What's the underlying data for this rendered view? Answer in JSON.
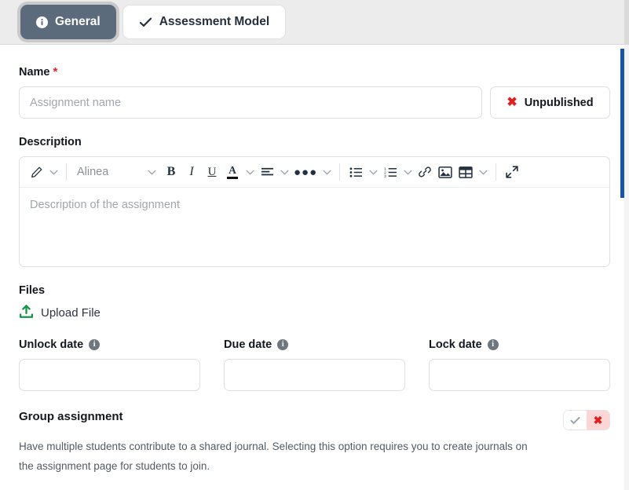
{
  "tabs": [
    {
      "label": "General",
      "icon": "info-circle-icon",
      "active": true
    },
    {
      "label": "Assessment Model",
      "icon": "check-icon",
      "active": false
    }
  ],
  "name_section": {
    "label": "Name",
    "required_marker": "*",
    "placeholder": "Assignment name",
    "value": "",
    "publish_button": {
      "label": "Unpublished",
      "icon": "x-icon",
      "icon_color": "#e02020"
    }
  },
  "description_section": {
    "label": "Description",
    "placeholder": "Description of the assignment",
    "value": "",
    "toolbar": {
      "style_picker_icon": "pencil-icon",
      "font_name": "Alinea",
      "bold_label": "B",
      "italic_label": "I",
      "underline_label": "U",
      "text_color_label": "A",
      "text_color_swatch": "#111111",
      "align_icon": "align-left-icon",
      "more_icon": "ellipsis-icon",
      "bullet_list_icon": "bullet-list-icon",
      "numbered_list_icon": "numbered-list-icon",
      "link_icon": "link-icon",
      "image_icon": "image-icon",
      "table_icon": "table-icon",
      "fullscreen_icon": "fullscreen-icon"
    }
  },
  "files_section": {
    "label": "Files",
    "upload_label": "Upload File",
    "upload_icon": "upload-icon",
    "upload_icon_color": "#159445"
  },
  "dates": [
    {
      "label": "Unlock date",
      "info_icon": "info-icon",
      "value": "",
      "name": "unlock-date"
    },
    {
      "label": "Due date",
      "info_icon": "info-icon",
      "value": "",
      "name": "due-date"
    },
    {
      "label": "Lock date",
      "info_icon": "info-icon",
      "value": "",
      "name": "lock-date"
    }
  ],
  "group_assignment": {
    "title": "Group assignment",
    "description": "Have multiple students contribute to a shared journal. Selecting this option requires you to create journals on the assignment page for students to join.",
    "toggle": {
      "yes_icon": "check-icon",
      "no_icon": "x-icon",
      "selected": "no",
      "selected_color": "#e02020",
      "selected_bg": "#fcd5d5"
    }
  },
  "scrollbar": {
    "accent_color": "#1a56a8"
  },
  "info_char": "i"
}
